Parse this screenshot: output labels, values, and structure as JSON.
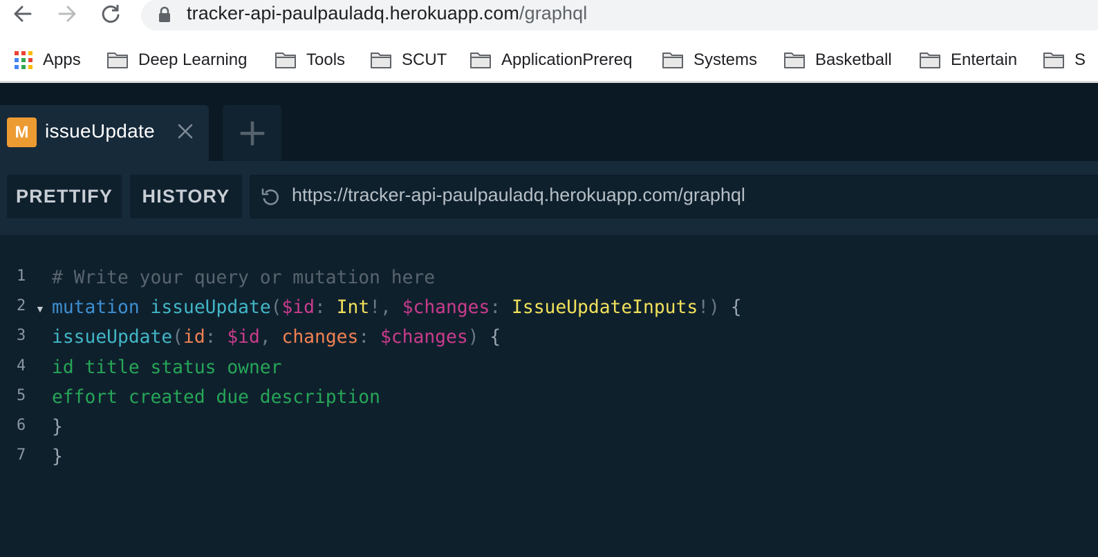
{
  "browser": {
    "url_host": "tracker-api-paulpauladq.herokuapp.com",
    "url_path": "/graphql",
    "bookmarks": [
      "Apps",
      "Deep Learning",
      "Tools",
      "SCUT",
      "ApplicationPrereq",
      "Systems",
      "Basketball",
      "Entertain",
      "S"
    ]
  },
  "playground": {
    "tab": {
      "badge": "M",
      "title": "issueUpdate"
    },
    "buttons": {
      "prettify": "PRETTIFY",
      "history": "HISTORY"
    },
    "endpoint": "https://tracker-api-paulpauladq.herokuapp.com/graphql",
    "editor": {
      "line_numbers": [
        "1",
        "2",
        "3",
        "4",
        "5",
        "6",
        "7"
      ],
      "lines": [
        [
          {
            "t": "comment",
            "v": "# Write your query or mutation here"
          }
        ],
        [
          {
            "t": "kw",
            "v": "mutation"
          },
          {
            "t": "plain",
            "v": " "
          },
          {
            "t": "def",
            "v": "issueUpdate"
          },
          {
            "t": "punc",
            "v": "("
          },
          {
            "t": "var",
            "v": "$id"
          },
          {
            "t": "punc",
            "v": ": "
          },
          {
            "t": "type",
            "v": "Int"
          },
          {
            "t": "punc",
            "v": "!, "
          },
          {
            "t": "var",
            "v": "$changes"
          },
          {
            "t": "punc",
            "v": ": "
          },
          {
            "t": "type",
            "v": "IssueUpdateInputs"
          },
          {
            "t": "punc",
            "v": "!) "
          },
          {
            "t": "brace",
            "v": "{"
          }
        ],
        [
          {
            "t": "def",
            "v": "issueUpdate"
          },
          {
            "t": "punc",
            "v": "("
          },
          {
            "t": "arg",
            "v": "id"
          },
          {
            "t": "punc",
            "v": ": "
          },
          {
            "t": "var",
            "v": "$id"
          },
          {
            "t": "punc",
            "v": ", "
          },
          {
            "t": "arg",
            "v": "changes"
          },
          {
            "t": "punc",
            "v": ": "
          },
          {
            "t": "var",
            "v": "$changes"
          },
          {
            "t": "punc",
            "v": ") "
          },
          {
            "t": "brace",
            "v": "{"
          }
        ],
        [
          {
            "t": "field",
            "v": "id title status owner"
          }
        ],
        [
          {
            "t": "field",
            "v": "effort created due description"
          }
        ],
        [
          {
            "t": "brace",
            "v": "}"
          }
        ],
        [
          {
            "t": "brace",
            "v": "}"
          }
        ]
      ]
    }
  }
}
